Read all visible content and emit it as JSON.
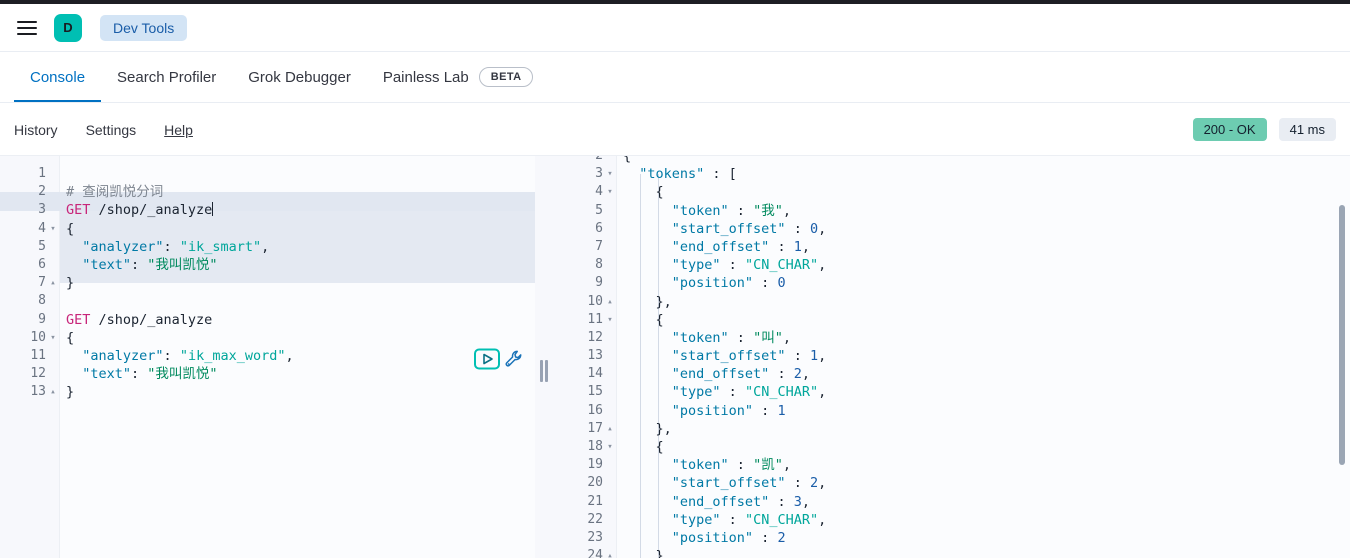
{
  "header": {
    "menu_icon": "hamburger-menu-icon",
    "avatar_initial": "D",
    "breadcrumb": "Dev Tools"
  },
  "tabs": [
    {
      "label": "Console",
      "active": true,
      "badge": ""
    },
    {
      "label": "Search Profiler",
      "active": false,
      "badge": ""
    },
    {
      "label": "Grok Debugger",
      "active": false,
      "badge": ""
    },
    {
      "label": "Painless Lab",
      "active": false,
      "badge": "BETA"
    }
  ],
  "console_toolbar": {
    "links": [
      "History",
      "Settings",
      "Help"
    ],
    "status": "200 - OK",
    "time": "41 ms"
  },
  "colors": {
    "accent": "#0071c2",
    "brand_teal": "#00bfb3",
    "status_ok_bg": "#6dccb1",
    "time_bg": "#e9edf3",
    "breadcrumb_bg": "#d3e4f5",
    "method": "#c8257a",
    "json_key": "#0079a5",
    "json_string": "#00a69b",
    "cjk_string": "#008a5e",
    "number": "#1a5da8",
    "comment": "#7d8590",
    "highlight_block": "#e4e9f2"
  },
  "request_editor": {
    "first_visible_line": 1,
    "icons": {
      "run": "play-icon",
      "wrench": "wrench-icon"
    },
    "lines": [
      {
        "n": 1,
        "fold": "",
        "tokens": []
      },
      {
        "n": 2,
        "fold": "",
        "tokens": [
          {
            "c": "t-comment",
            "t": "# 查阅凯悦分词"
          }
        ]
      },
      {
        "n": 3,
        "fold": "",
        "tokens": [
          {
            "c": "t-method",
            "t": "GET"
          },
          {
            "c": "t-url",
            "t": " /shop/_analyze"
          },
          {
            "c": "cursor",
            "t": ""
          }
        ]
      },
      {
        "n": 4,
        "fold": "▾",
        "tokens": [
          {
            "c": "t-brace",
            "t": "{"
          }
        ]
      },
      {
        "n": 5,
        "fold": "",
        "tokens": [
          {
            "c": "t-key",
            "t": "  \"analyzer\""
          },
          {
            "c": "t-punct",
            "t": ": "
          },
          {
            "c": "t-str",
            "t": "\"ik_smart\""
          },
          {
            "c": "t-punct",
            "t": ","
          }
        ]
      },
      {
        "n": 6,
        "fold": "",
        "tokens": [
          {
            "c": "t-key",
            "t": "  \"text\""
          },
          {
            "c": "t-punct",
            "t": ": "
          },
          {
            "c": "t-strcn",
            "t": "\"我叫凯悦\""
          }
        ]
      },
      {
        "n": 7,
        "fold": "▴",
        "tokens": [
          {
            "c": "t-brace",
            "t": "}"
          }
        ]
      },
      {
        "n": 8,
        "fold": "",
        "tokens": []
      },
      {
        "n": 9,
        "fold": "",
        "tokens": [
          {
            "c": "t-method",
            "t": "GET"
          },
          {
            "c": "t-url",
            "t": " /shop/_analyze"
          }
        ]
      },
      {
        "n": 10,
        "fold": "▾",
        "tokens": [
          {
            "c": "t-brace",
            "t": "{"
          }
        ]
      },
      {
        "n": 11,
        "fold": "",
        "tokens": [
          {
            "c": "t-key",
            "t": "  \"analyzer\""
          },
          {
            "c": "t-punct",
            "t": ": "
          },
          {
            "c": "t-str",
            "t": "\"ik_max_word\""
          },
          {
            "c": "t-punct",
            "t": ","
          }
        ]
      },
      {
        "n": 12,
        "fold": "",
        "tokens": [
          {
            "c": "t-key",
            "t": "  \"text\""
          },
          {
            "c": "t-punct",
            "t": ": "
          },
          {
            "c": "t-strcn",
            "t": "\"我叫凯悦\""
          }
        ]
      },
      {
        "n": 13,
        "fold": "▴",
        "tokens": [
          {
            "c": "t-brace",
            "t": "}"
          }
        ]
      }
    ]
  },
  "response_editor": {
    "scrolled": true,
    "lines": [
      {
        "n": 2,
        "fold": "",
        "tokens": [
          {
            "c": "t-brace",
            "t": "{"
          }
        ]
      },
      {
        "n": 3,
        "fold": "▾",
        "tokens": [
          {
            "c": "t-rkey",
            "t": "  \"tokens\""
          },
          {
            "c": "t-punct",
            "t": " : ["
          }
        ]
      },
      {
        "n": 4,
        "fold": "▾",
        "tokens": [
          {
            "c": "t-brace",
            "t": "    {"
          }
        ]
      },
      {
        "n": 5,
        "fold": "",
        "tokens": [
          {
            "c": "t-rkey",
            "t": "      \"token\""
          },
          {
            "c": "t-punct",
            "t": " : "
          },
          {
            "c": "t-strcn",
            "t": "\"我\""
          },
          {
            "c": "t-punct",
            "t": ","
          }
        ]
      },
      {
        "n": 6,
        "fold": "",
        "tokens": [
          {
            "c": "t-rkey",
            "t": "      \"start_offset\""
          },
          {
            "c": "t-punct",
            "t": " : "
          },
          {
            "c": "t-rnum",
            "t": "0"
          },
          {
            "c": "t-punct",
            "t": ","
          }
        ]
      },
      {
        "n": 7,
        "fold": "",
        "tokens": [
          {
            "c": "t-rkey",
            "t": "      \"end_offset\""
          },
          {
            "c": "t-punct",
            "t": " : "
          },
          {
            "c": "t-rnum",
            "t": "1"
          },
          {
            "c": "t-punct",
            "t": ","
          }
        ]
      },
      {
        "n": 8,
        "fold": "",
        "tokens": [
          {
            "c": "t-rkey",
            "t": "      \"type\""
          },
          {
            "c": "t-punct",
            "t": " : "
          },
          {
            "c": "t-rstr",
            "t": "\"CN_CHAR\""
          },
          {
            "c": "t-punct",
            "t": ","
          }
        ]
      },
      {
        "n": 9,
        "fold": "",
        "tokens": [
          {
            "c": "t-rkey",
            "t": "      \"position\""
          },
          {
            "c": "t-punct",
            "t": " : "
          },
          {
            "c": "t-rnum",
            "t": "0"
          }
        ]
      },
      {
        "n": 10,
        "fold": "▴",
        "tokens": [
          {
            "c": "t-brace",
            "t": "    },"
          }
        ]
      },
      {
        "n": 11,
        "fold": "▾",
        "tokens": [
          {
            "c": "t-brace",
            "t": "    {"
          }
        ]
      },
      {
        "n": 12,
        "fold": "",
        "tokens": [
          {
            "c": "t-rkey",
            "t": "      \"token\""
          },
          {
            "c": "t-punct",
            "t": " : "
          },
          {
            "c": "t-strcn",
            "t": "\"叫\""
          },
          {
            "c": "t-punct",
            "t": ","
          }
        ]
      },
      {
        "n": 13,
        "fold": "",
        "tokens": [
          {
            "c": "t-rkey",
            "t": "      \"start_offset\""
          },
          {
            "c": "t-punct",
            "t": " : "
          },
          {
            "c": "t-rnum",
            "t": "1"
          },
          {
            "c": "t-punct",
            "t": ","
          }
        ]
      },
      {
        "n": 14,
        "fold": "",
        "tokens": [
          {
            "c": "t-rkey",
            "t": "      \"end_offset\""
          },
          {
            "c": "t-punct",
            "t": " : "
          },
          {
            "c": "t-rnum",
            "t": "2"
          },
          {
            "c": "t-punct",
            "t": ","
          }
        ]
      },
      {
        "n": 15,
        "fold": "",
        "tokens": [
          {
            "c": "t-rkey",
            "t": "      \"type\""
          },
          {
            "c": "t-punct",
            "t": " : "
          },
          {
            "c": "t-rstr",
            "t": "\"CN_CHAR\""
          },
          {
            "c": "t-punct",
            "t": ","
          }
        ]
      },
      {
        "n": 16,
        "fold": "",
        "tokens": [
          {
            "c": "t-rkey",
            "t": "      \"position\""
          },
          {
            "c": "t-punct",
            "t": " : "
          },
          {
            "c": "t-rnum",
            "t": "1"
          }
        ]
      },
      {
        "n": 17,
        "fold": "▴",
        "tokens": [
          {
            "c": "t-brace",
            "t": "    },"
          }
        ]
      },
      {
        "n": 18,
        "fold": "▾",
        "tokens": [
          {
            "c": "t-brace",
            "t": "    {"
          }
        ]
      },
      {
        "n": 19,
        "fold": "",
        "tokens": [
          {
            "c": "t-rkey",
            "t": "      \"token\""
          },
          {
            "c": "t-punct",
            "t": " : "
          },
          {
            "c": "t-strcn",
            "t": "\"凯\""
          },
          {
            "c": "t-punct",
            "t": ","
          }
        ]
      },
      {
        "n": 20,
        "fold": "",
        "tokens": [
          {
            "c": "t-rkey",
            "t": "      \"start_offset\""
          },
          {
            "c": "t-punct",
            "t": " : "
          },
          {
            "c": "t-rnum",
            "t": "2"
          },
          {
            "c": "t-punct",
            "t": ","
          }
        ]
      },
      {
        "n": 21,
        "fold": "",
        "tokens": [
          {
            "c": "t-rkey",
            "t": "      \"end_offset\""
          },
          {
            "c": "t-punct",
            "t": " : "
          },
          {
            "c": "t-rnum",
            "t": "3"
          },
          {
            "c": "t-punct",
            "t": ","
          }
        ]
      },
      {
        "n": 22,
        "fold": "",
        "tokens": [
          {
            "c": "t-rkey",
            "t": "      \"type\""
          },
          {
            "c": "t-punct",
            "t": " : "
          },
          {
            "c": "t-rstr",
            "t": "\"CN_CHAR\""
          },
          {
            "c": "t-punct",
            "t": ","
          }
        ]
      },
      {
        "n": 23,
        "fold": "",
        "tokens": [
          {
            "c": "t-rkey",
            "t": "      \"position\""
          },
          {
            "c": "t-punct",
            "t": " : "
          },
          {
            "c": "t-rnum",
            "t": "2"
          }
        ]
      },
      {
        "n": 24,
        "fold": "▴",
        "tokens": [
          {
            "c": "t-brace",
            "t": "    },"
          }
        ]
      }
    ]
  }
}
